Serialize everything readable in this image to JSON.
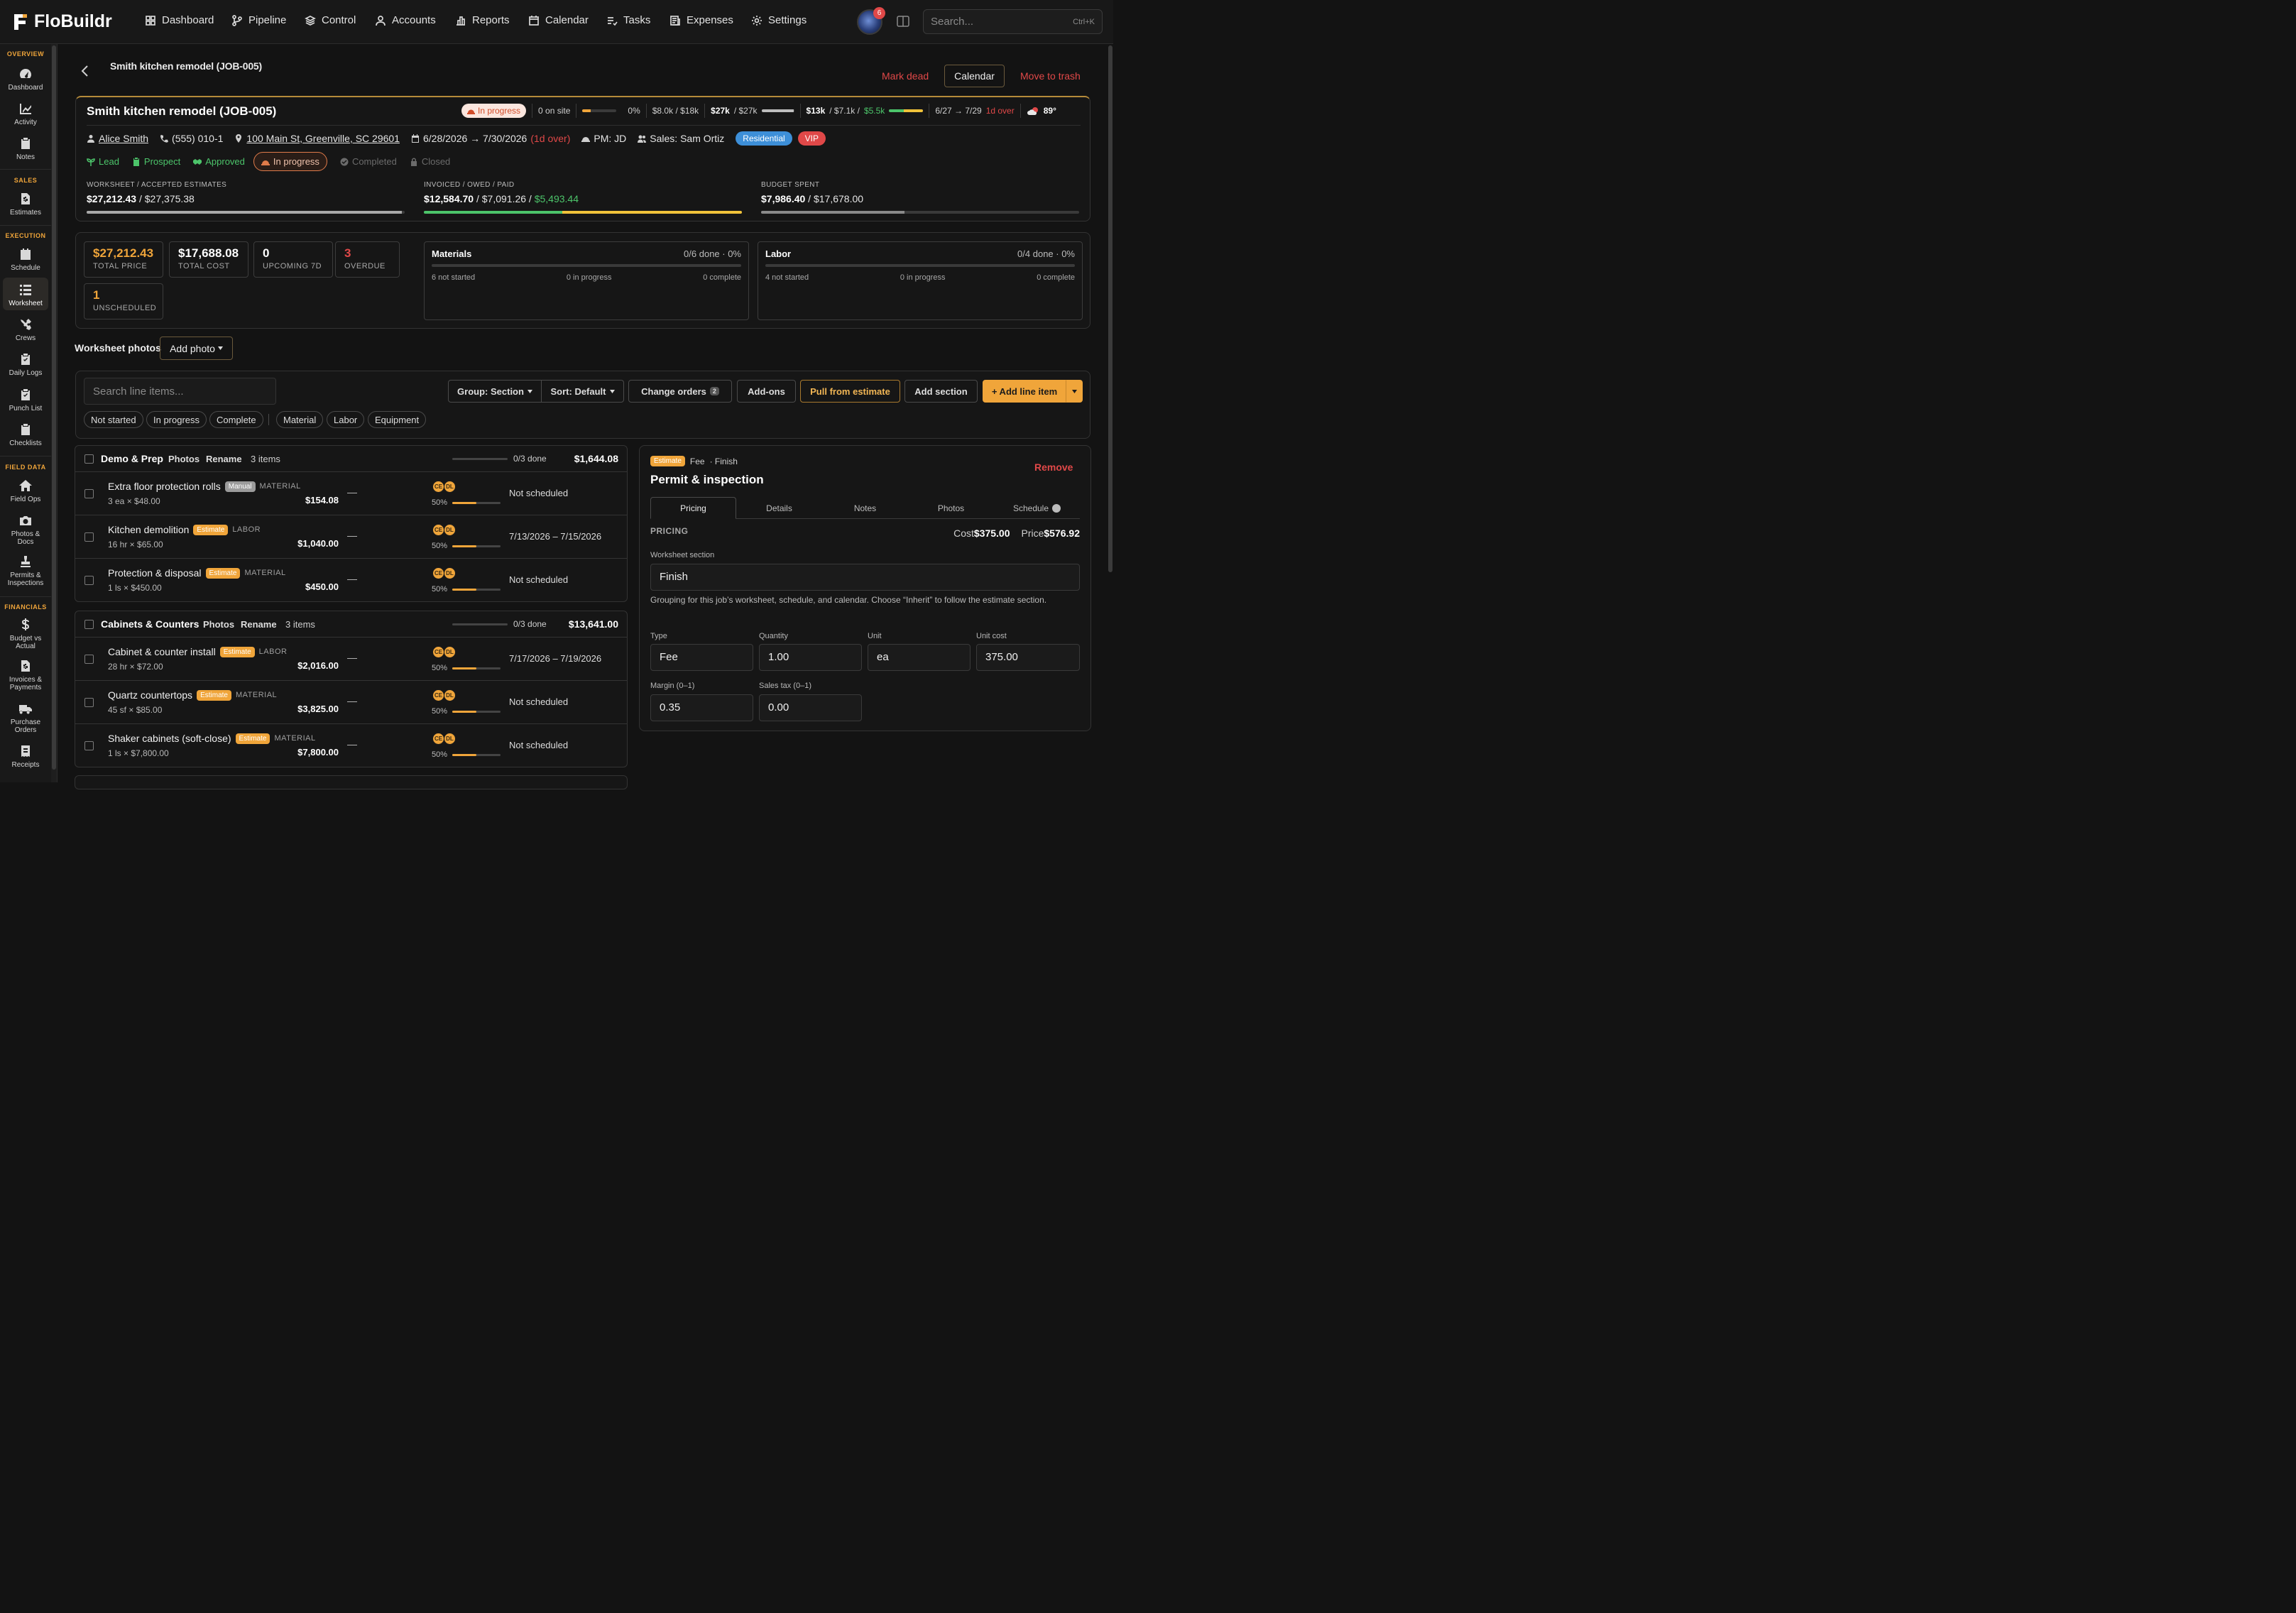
{
  "app": {
    "name": "FloBuildr"
  },
  "nav": {
    "items": [
      "Dashboard",
      "Pipeline",
      "Control",
      "Accounts",
      "Reports",
      "Calendar",
      "Tasks",
      "Expenses",
      "Settings"
    ],
    "notif_count": "6",
    "search_placeholder": "Search...",
    "search_shortcut": "Ctrl+K"
  },
  "sidebar": {
    "overview": "OVERVIEW",
    "sales": "SALES",
    "execution": "EXECUTION",
    "field_data": "FIELD DATA",
    "financials": "FINANCIALS",
    "items": [
      "Dashboard",
      "Activity",
      "Notes",
      "Estimates",
      "Schedule",
      "Worksheet",
      "Crews",
      "Daily Logs",
      "Punch List",
      "Checklists",
      "Field Ops",
      "Photos & Docs",
      "Permits & Inspections",
      "Budget vs Actual",
      "Invoices & Payments",
      "Purchase Orders",
      "Receipts"
    ]
  },
  "header": {
    "breadcrumb": "Smith kitchen remodel (JOB-005)",
    "mark_dead": "Mark dead",
    "calendar": "Calendar",
    "move_to_trash": "Move to trash"
  },
  "job": {
    "title": "Smith kitchen remodel (JOB-005)",
    "status": "In progress",
    "on_site": "0 on site",
    "progress_pct": "0%",
    "budget_short": "$8.0k / $18k",
    "estimate_bold": "$27k",
    "estimate_rest": "/ $27k",
    "invoice_bold": "$13k",
    "invoice_mid": "/ $7.1k /",
    "invoice_paid": "$5.5k",
    "dates_short": "6/27 → 7/29",
    "over_short": "1d over",
    "weather": "89°",
    "customer": "Alice Smith",
    "phone": "(555) 010-1",
    "address": "100 Main St, Greenville, SC 29601",
    "dates": "6/28/2026 → 7/30/2026",
    "over": "(1d over)",
    "pm": "PM: JD",
    "sales": "Sales: Sam Ortiz",
    "tags": [
      "Residential",
      "VIP"
    ],
    "stages": [
      "Lead",
      "Prospect",
      "Approved",
      "In progress",
      "Completed",
      "Closed"
    ],
    "fin": [
      {
        "label": "WORKSHEET / ACCEPTED ESTIMATES",
        "bold": "$27,212.43",
        "rest": " / $27,375.38",
        "pct": 99
      },
      {
        "label": "INVOICED / OWED / PAID",
        "bold": "$12,584.70",
        "mid": " / $7,091.26 / ",
        "paid": "$5,493.44"
      },
      {
        "label": "BUDGET SPENT",
        "bold": "$7,986.40",
        "rest": " / $17,678.00",
        "pct": 45
      }
    ],
    "colors": {
      "accent": "#f0a53a",
      "danger": "#e04848",
      "success": "#4cc46a",
      "info": "#3d8fd8"
    }
  },
  "summary": {
    "stats": [
      {
        "value": "$27,212.43",
        "label": "TOTAL PRICE",
        "color": "#f0a53a"
      },
      {
        "value": "$17,688.08",
        "label": "TOTAL COST",
        "color": "#ffffff"
      },
      {
        "value": "0",
        "label": "UPCOMING 7D",
        "color": "#ffffff"
      },
      {
        "value": "3",
        "label": "OVERDUE",
        "color": "#e04848"
      },
      {
        "value": "1",
        "label": "UNSCHEDULED",
        "color": "#f0a53a"
      }
    ],
    "materials": {
      "title": "Materials",
      "done": "0/6 done · 0%",
      "not_started": "6 not started",
      "in_progress": "0 in progress",
      "complete": "0 complete"
    },
    "labor": {
      "title": "Labor",
      "done": "0/4 done · 0%",
      "not_started": "4 not started",
      "in_progress": "0 in progress",
      "complete": "0 complete"
    }
  },
  "photos": {
    "label": "Worksheet photos",
    "add": "Add photo"
  },
  "toolbar": {
    "search_placeholder": "Search line items...",
    "group": "Group: Section",
    "sort": "Sort: Default",
    "change_orders": "Change orders",
    "change_orders_count": "2",
    "addons": "Add-ons",
    "pull": "Pull from estimate",
    "add_section": "Add section",
    "add_line": "+ Add line item",
    "chips": [
      "Not started",
      "In progress",
      "Complete",
      "Material",
      "Labor",
      "Equipment"
    ]
  },
  "sections": [
    {
      "name": "Demo & Prep",
      "photos": "Photos",
      "rename": "Rename",
      "count": "3 items",
      "done": "0/3 done",
      "total": "$1,644.08",
      "items": [
        {
          "name": "Extra floor protection rolls",
          "badge": "Manual",
          "kind": "MATERIAL",
          "qty": "3 ea × $48.00",
          "amount": "$154.08",
          "pct": "50%",
          "sched": "Not scheduled"
        },
        {
          "name": "Kitchen demolition",
          "badge": "Estimate",
          "kind": "LABOR",
          "qty": "16 hr × $65.00",
          "amount": "$1,040.00",
          "pct": "50%",
          "sched": "7/13/2026 – 7/15/2026"
        },
        {
          "name": "Protection & disposal",
          "badge": "Estimate",
          "kind": "MATERIAL",
          "qty": "1 ls × $450.00",
          "amount": "$450.00",
          "pct": "50%",
          "sched": "Not scheduled"
        }
      ]
    },
    {
      "name": "Cabinets & Counters",
      "photos": "Photos",
      "rename": "Rename",
      "count": "3 items",
      "done": "0/3 done",
      "total": "$13,641.00",
      "items": [
        {
          "name": "Cabinet & counter install",
          "badge": "Estimate",
          "kind": "LABOR",
          "qty": "28 hr × $72.00",
          "amount": "$2,016.00",
          "pct": "50%",
          "sched": "7/17/2026 – 7/19/2026"
        },
        {
          "name": "Quartz countertops",
          "badge": "Estimate",
          "kind": "MATERIAL",
          "qty": "45 sf × $85.00",
          "amount": "$3,825.00",
          "pct": "50%",
          "sched": "Not scheduled"
        },
        {
          "name": "Shaker cabinets (soft-close)",
          "badge": "Estimate",
          "kind": "MATERIAL",
          "qty": "1 ls × $7,800.00",
          "amount": "$7,800.00",
          "pct": "50%",
          "sched": "Not scheduled"
        }
      ]
    }
  ],
  "avatars": [
    "CE",
    "DL"
  ],
  "detail": {
    "badge": "Estimate",
    "type_line": "Fee",
    "section_line": "· Finish",
    "title": "Permit & inspection",
    "remove": "Remove",
    "tabs": [
      "Pricing",
      "Details",
      "Notes",
      "Photos",
      "Schedule"
    ],
    "pricing_label": "PRICING",
    "cost_label": "Cost",
    "cost": "$375.00",
    "price_label": "Price",
    "price": "$576.92",
    "section_label": "Worksheet section",
    "section_value": "Finish",
    "help": "Grouping for this job’s worksheet, schedule, and calendar. Choose “Inherit” to follow the estimate section.",
    "type_label": "Type",
    "type_value": "Fee",
    "qty_label": "Quantity",
    "qty_value": "1.00",
    "unit_label": "Unit",
    "unit_value": "ea",
    "unitcost_label": "Unit cost",
    "unitcost_value": "375.00",
    "margin_label": "Margin (0–1)",
    "margin_value": "0.35",
    "tax_label": "Sales tax (0–1)",
    "tax_value": "0.00"
  }
}
